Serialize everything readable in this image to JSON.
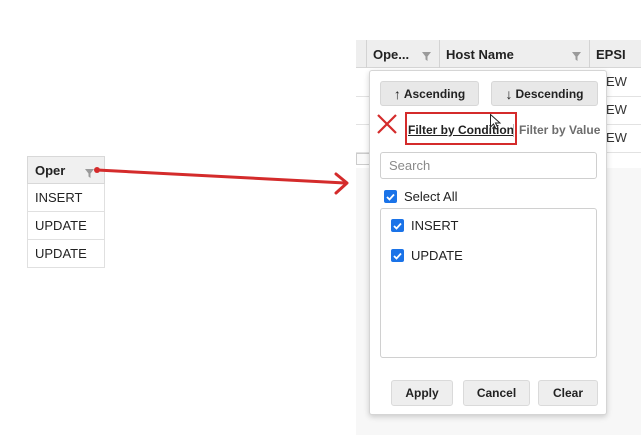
{
  "left_table": {
    "header": "Oper",
    "rows": [
      "INSERT",
      "UPDATE",
      "UPDATE"
    ]
  },
  "grid": {
    "columns": [
      "Ope...",
      "Host Name",
      "EPSI"
    ],
    "row_fragments": [
      "EW",
      "EW",
      "EW"
    ]
  },
  "popup": {
    "sort_ascending": "Ascending",
    "sort_descending": "Descending",
    "arrow_up": "↑",
    "arrow_down": "↓",
    "filter_by_condition": "Filter by Condition",
    "filter_by_value": "Filter by Value",
    "search_placeholder": "Search",
    "select_all": "Select All",
    "values": [
      "INSERT",
      "UPDATE"
    ],
    "apply": "Apply",
    "cancel": "Cancel",
    "clear": "Clear"
  },
  "colors": {
    "annotation_red": "#d42b2b",
    "checkbox_blue": "#1a73e8"
  }
}
